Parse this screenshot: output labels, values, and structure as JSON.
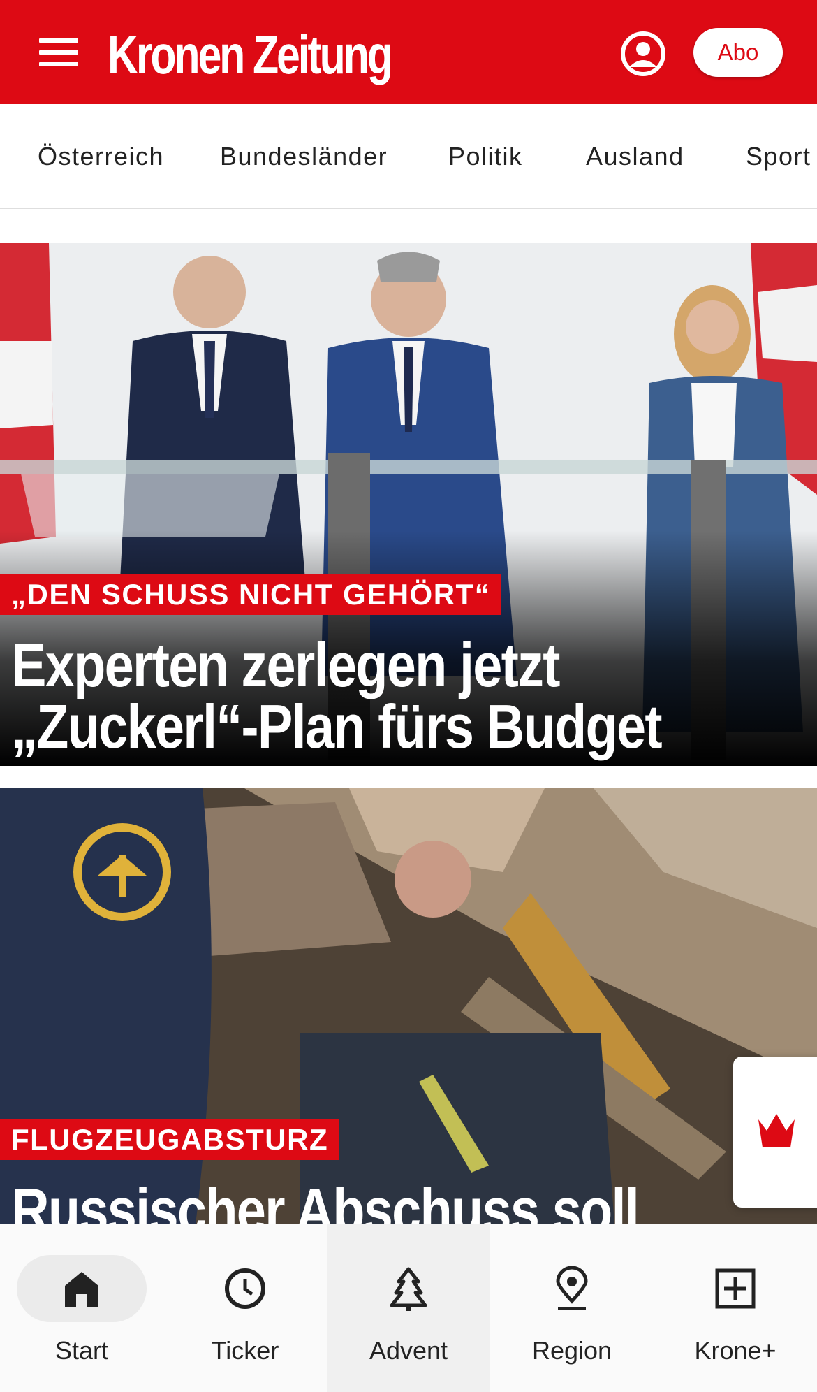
{
  "header": {
    "logo_text": "Kronen Zeitung",
    "menu_icon": "hamburger-menu-icon",
    "account_icon": "user-circle-icon",
    "subscribe_label": "Abo",
    "brand_color": "#dd0a14"
  },
  "nav": {
    "items": [
      {
        "label": "Österreich"
      },
      {
        "label": "Bundesländer"
      },
      {
        "label": "Politik"
      },
      {
        "label": "Ausland"
      },
      {
        "label": "Sport"
      }
    ]
  },
  "articles": [
    {
      "kicker": "„DEN SCHUSS NICHT GEHÖRT“",
      "headline_line1": "Experten zerlegen jetzt",
      "headline_line2": "„Zuckerl“-Plan fürs Budget"
    },
    {
      "kicker": "FLUGZEUGABSTURZ",
      "headline_line1": "Russischer Abschuss soll"
    }
  ],
  "side_tab": {
    "icon": "krone-crown-icon"
  },
  "bottom_nav": {
    "items": [
      {
        "label": "Start",
        "icon": "home-icon",
        "active": true
      },
      {
        "label": "Ticker",
        "icon": "clock-icon"
      },
      {
        "label": "Advent",
        "icon": "tree-icon"
      },
      {
        "label": "Region",
        "icon": "location-pin-icon"
      },
      {
        "label": "Krone+",
        "icon": "plus-box-icon"
      }
    ]
  }
}
